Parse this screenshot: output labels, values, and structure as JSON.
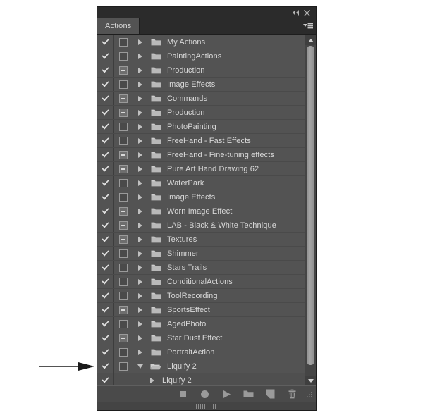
{
  "panel": {
    "tab_label": "Actions",
    "titlebar": {
      "collapse_label": "◀◀",
      "close_label": "✕"
    },
    "menu_label": "≡"
  },
  "rows": [
    {
      "name": "My Actions",
      "checked": true,
      "modal": false,
      "expanded": false,
      "type": "set"
    },
    {
      "name": "PaintingActions",
      "checked": true,
      "modal": false,
      "expanded": false,
      "type": "set"
    },
    {
      "name": "Production",
      "checked": true,
      "modal": true,
      "expanded": false,
      "type": "set"
    },
    {
      "name": "Image Effects",
      "checked": true,
      "modal": false,
      "expanded": false,
      "type": "set"
    },
    {
      "name": "Commands",
      "checked": true,
      "modal": true,
      "expanded": false,
      "type": "set"
    },
    {
      "name": "Production",
      "checked": true,
      "modal": true,
      "expanded": false,
      "type": "set"
    },
    {
      "name": "PhotoPainting",
      "checked": true,
      "modal": false,
      "expanded": false,
      "type": "set"
    },
    {
      "name": "FreeHand - Fast Effects",
      "checked": true,
      "modal": false,
      "expanded": false,
      "type": "set"
    },
    {
      "name": "FreeHand - Fine-tuning effects",
      "checked": true,
      "modal": true,
      "expanded": false,
      "type": "set"
    },
    {
      "name": "Pure Art Hand Drawing 62",
      "checked": true,
      "modal": true,
      "expanded": false,
      "type": "set"
    },
    {
      "name": "WaterPark",
      "checked": true,
      "modal": false,
      "expanded": false,
      "type": "set"
    },
    {
      "name": "Image Effects",
      "checked": true,
      "modal": false,
      "expanded": false,
      "type": "set"
    },
    {
      "name": "Worn Image Effect",
      "checked": true,
      "modal": true,
      "expanded": false,
      "type": "set"
    },
    {
      "name": "LAB - Black & White Technique",
      "checked": true,
      "modal": true,
      "expanded": false,
      "type": "set"
    },
    {
      "name": "Textures",
      "checked": true,
      "modal": true,
      "expanded": false,
      "type": "set"
    },
    {
      "name": "Shimmer",
      "checked": true,
      "modal": false,
      "expanded": false,
      "type": "set"
    },
    {
      "name": "Stars Trails",
      "checked": true,
      "modal": false,
      "expanded": false,
      "type": "set"
    },
    {
      "name": "ConditionalActions",
      "checked": true,
      "modal": false,
      "expanded": false,
      "type": "set"
    },
    {
      "name": "ToolRecording",
      "checked": true,
      "modal": false,
      "expanded": false,
      "type": "set"
    },
    {
      "name": "SportsEffect",
      "checked": true,
      "modal": true,
      "expanded": false,
      "type": "set"
    },
    {
      "name": "AgedPhoto",
      "checked": true,
      "modal": false,
      "expanded": false,
      "type": "set"
    },
    {
      "name": "Star Dust Effect",
      "checked": true,
      "modal": true,
      "expanded": false,
      "type": "set"
    },
    {
      "name": "PortraitAction",
      "checked": true,
      "modal": false,
      "expanded": false,
      "type": "set"
    },
    {
      "name": "Liquify 2",
      "checked": true,
      "modal": false,
      "expanded": true,
      "type": "set"
    },
    {
      "name": "Liquify 2",
      "checked": true,
      "modal": false,
      "expanded": false,
      "type": "action"
    }
  ],
  "toolbar": {
    "buttons": [
      {
        "icon": "stop-icon",
        "label": "Stop playing/recording"
      },
      {
        "icon": "record-icon",
        "label": "Begin recording"
      },
      {
        "icon": "play-icon",
        "label": "Play selection"
      },
      {
        "icon": "new-set-icon",
        "label": "Create new set"
      },
      {
        "icon": "new-action-icon",
        "label": "Create new action"
      },
      {
        "icon": "trash-icon",
        "label": "Delete"
      }
    ]
  },
  "scrollbar": {
    "up_icon": "scroll-up-icon",
    "down_icon": "scroll-down-icon"
  },
  "annotation": {
    "arrow_icon": "pointer-arrow-icon",
    "color": "#1a1a1a"
  },
  "colors": {
    "panel_bg": "#535353",
    "titlebar_bg": "#2b2b2b",
    "text": "#d8d8d8",
    "icon": "#9a9a9a"
  }
}
